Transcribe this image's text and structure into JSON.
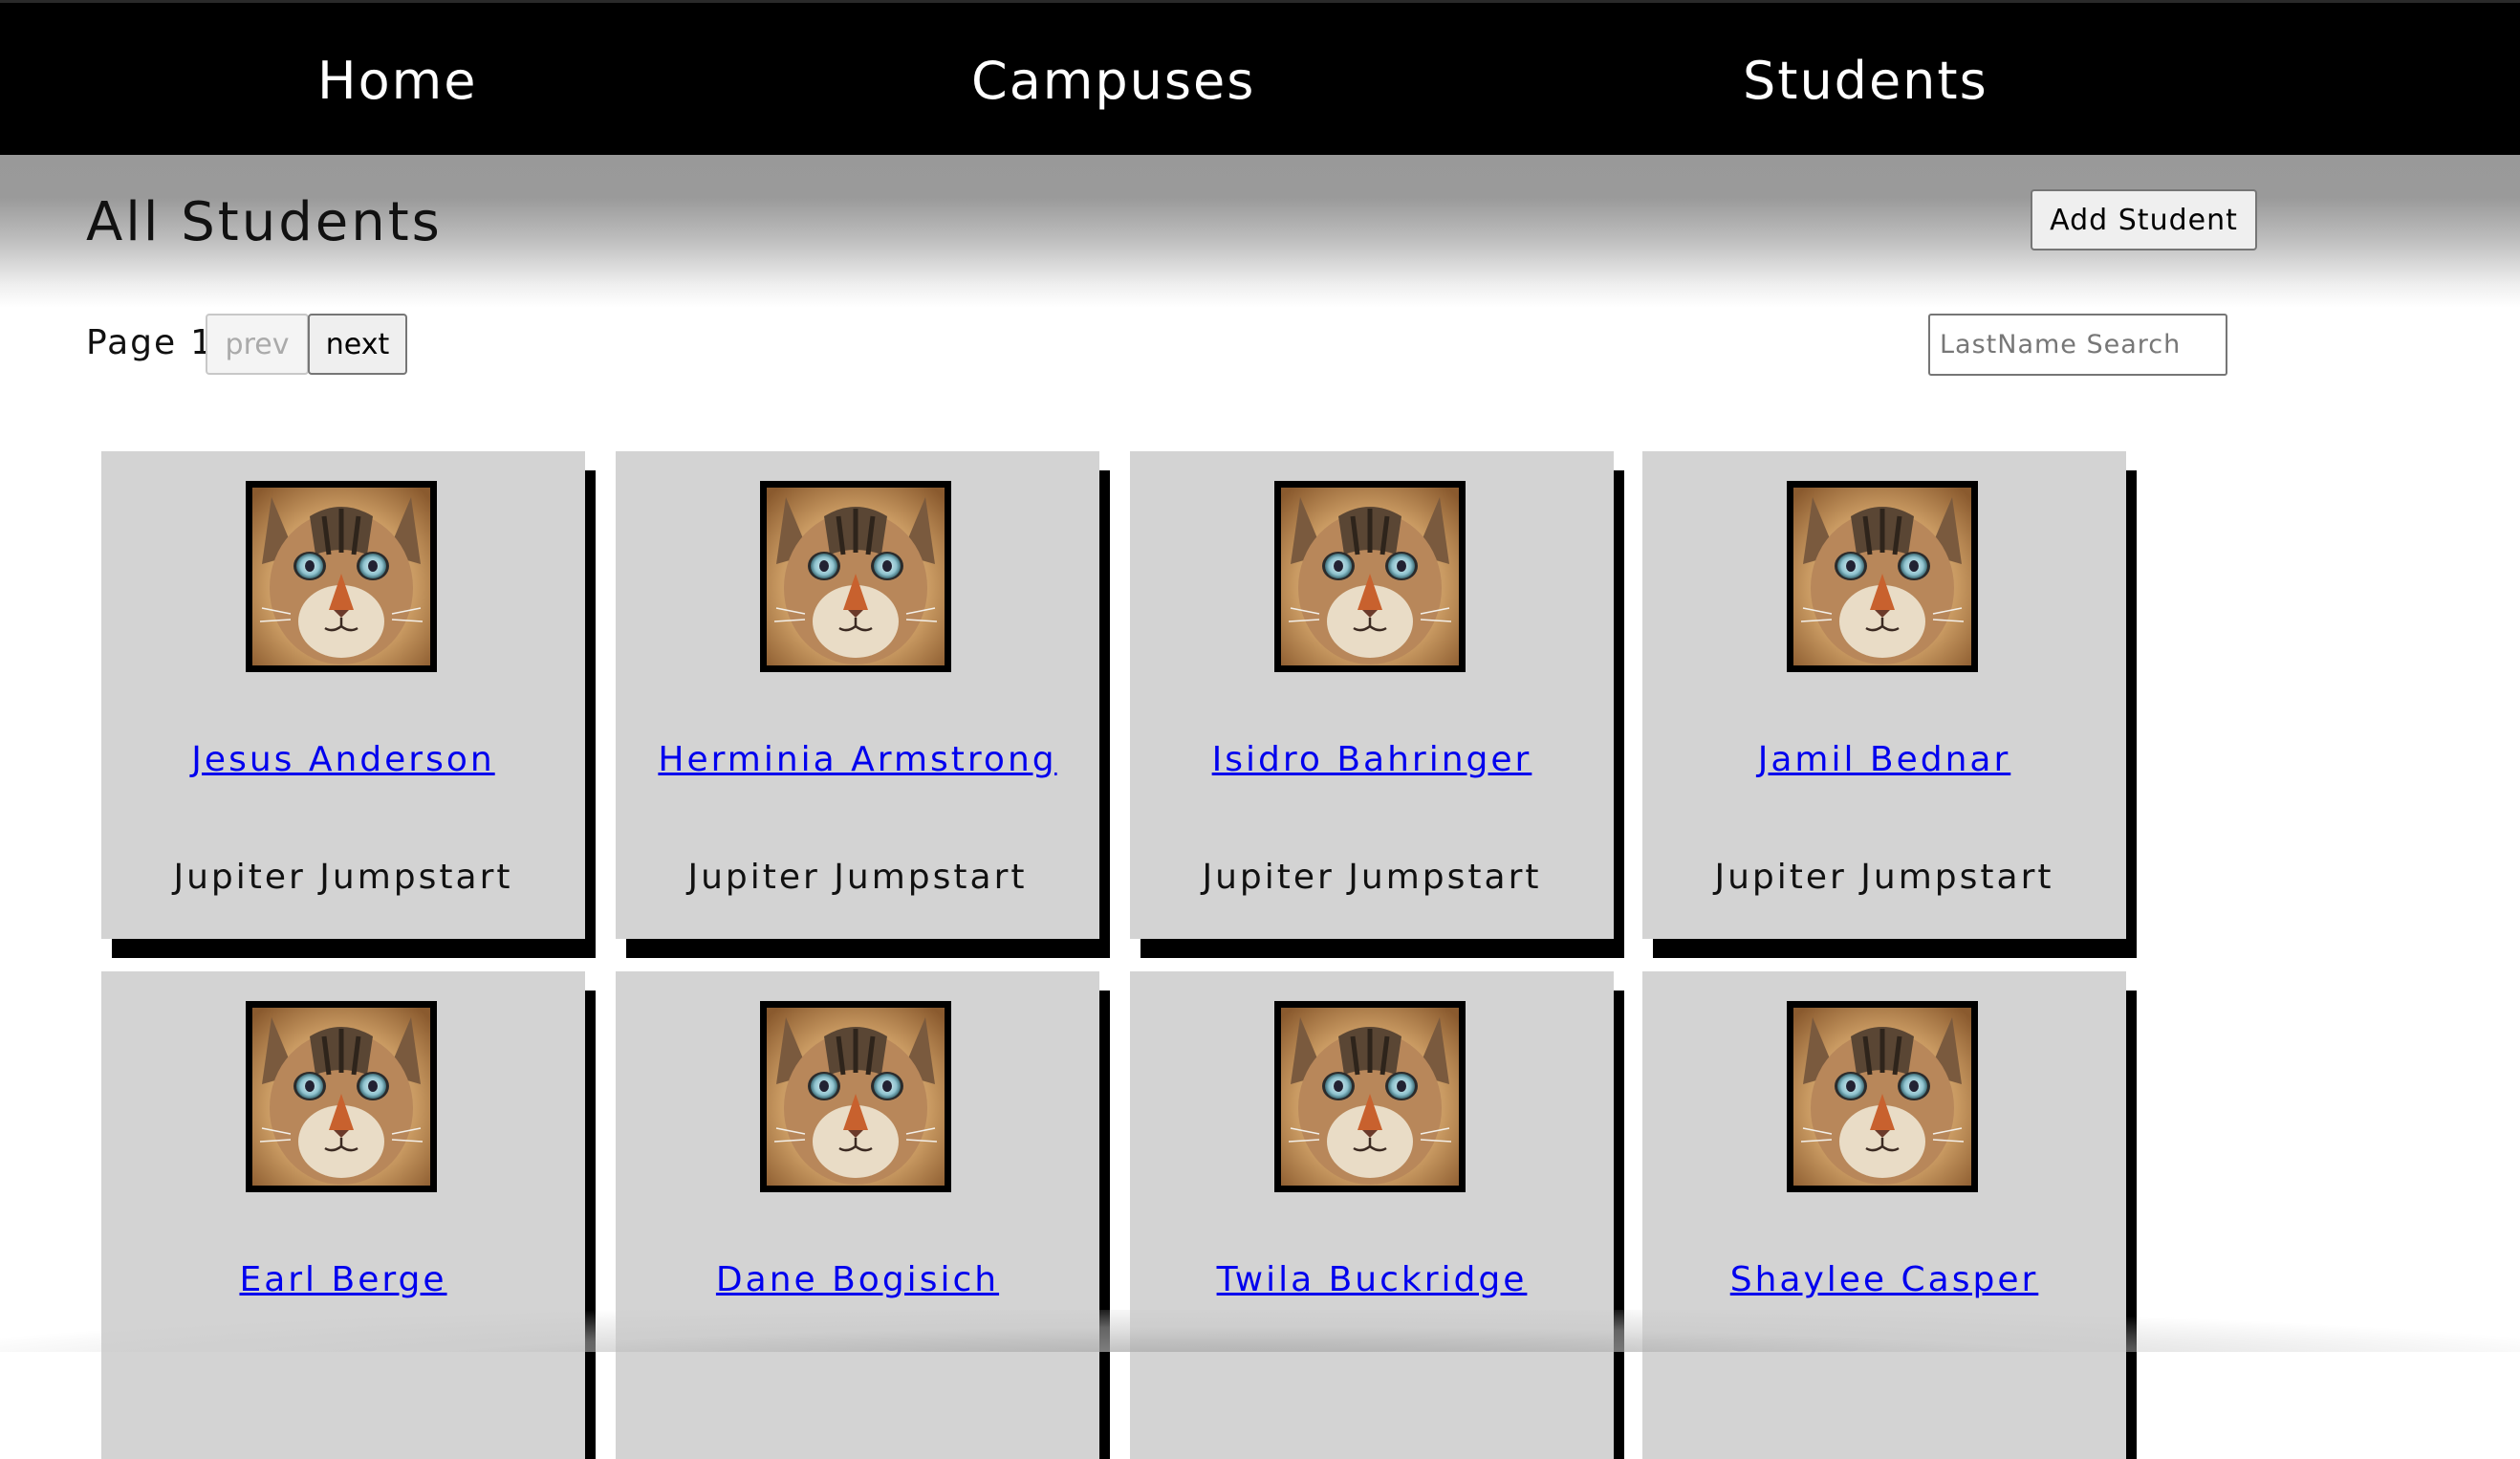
{
  "nav": {
    "home": "Home",
    "campuses": "Campuses",
    "students": "Students"
  },
  "header": {
    "title": "All Students",
    "add_button": "Add Student"
  },
  "pagination": {
    "page_label": "Page",
    "page_number": "1",
    "prev_label": "prev",
    "next_label": "next"
  },
  "search": {
    "placeholder": "LastName Search"
  },
  "students": [
    {
      "name": "Jesus Anderson",
      "campus": "Jupiter Jumpstart"
    },
    {
      "name": "Herminia Armstrong",
      "campus": "Jupiter Jumpstart"
    },
    {
      "name": "Isidro Bahringer",
      "campus": "Jupiter Jumpstart"
    },
    {
      "name": "Jamil Bednar",
      "campus": "Jupiter Jumpstart"
    },
    {
      "name": "Earl Berge",
      "campus": ""
    },
    {
      "name": "Dane Bogisich",
      "campus": ""
    },
    {
      "name": "Twila Buckridge",
      "campus": ""
    },
    {
      "name": "Shaylee Casper",
      "campus": ""
    }
  ],
  "colors": {
    "navbar": "#000000",
    "card": "#d3d3d3",
    "link": "#0000ee",
    "header_gradient_top": "#999999"
  },
  "icons": {
    "avatar": "cat-photo-icon"
  }
}
